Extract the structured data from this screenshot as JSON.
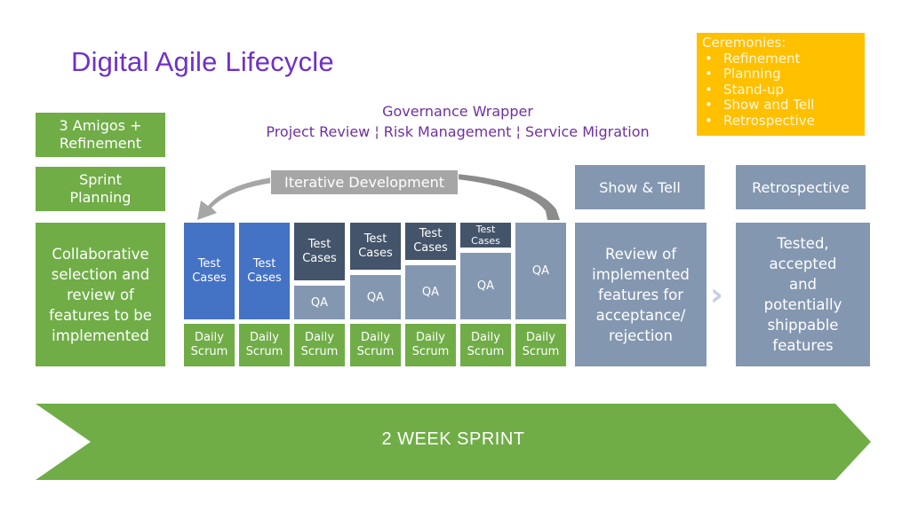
{
  "title": "Digital Agile Lifecycle",
  "ceremonies": {
    "heading": "Ceremonies:",
    "bullet": "•",
    "items": [
      "Refinement",
      "Planning",
      "Stand-up",
      "Show and Tell",
      "Retrospective"
    ]
  },
  "governance": {
    "heading": "Governance Wrapper",
    "items_line": "Project Review ¦ Risk Management ¦ Service Migration"
  },
  "left_column": {
    "amigos": "3 Amigos +\nRefinement",
    "sprint_planning": "Sprint\nPlanning",
    "planning_desc": "Collaborative\nselection and\nreview of\nfeatures to be\nimplemented"
  },
  "iterative_development": {
    "label": "Iterative Development",
    "arrow_icon": "curved-arrow-icon"
  },
  "sprint_days": [
    {
      "test_cases": "Test\nCases",
      "qa": null,
      "test_share": 1.0,
      "scrum": "Daily\nScrum"
    },
    {
      "test_cases": "Test\nCases",
      "qa": null,
      "test_share": 1.0,
      "scrum": "Daily\nScrum"
    },
    {
      "test_cases": "Test\nCases",
      "qa": "QA",
      "test_share": 0.62,
      "scrum": "Daily\nScrum"
    },
    {
      "test_cases": "Test\nCases",
      "qa": "QA",
      "test_share": 0.51,
      "scrum": "Daily\nScrum"
    },
    {
      "test_cases": "Test\nCases",
      "qa": "QA",
      "test_share": 0.41,
      "scrum": "Daily\nScrum"
    },
    {
      "test_cases": "Test\nCases",
      "qa": "QA",
      "test_share": 0.28,
      "scrum": "Daily\nScrum"
    },
    {
      "test_cases": null,
      "qa": "QA",
      "test_share": 0.0,
      "scrum": "Daily\nScrum"
    }
  ],
  "show_and_tell": {
    "label": "Show & Tell",
    "description": "Review of\nimplemented\nfeatures for\nacceptance/\nrejection"
  },
  "chevron_icon": "›",
  "retrospective": {
    "label": "Retrospective",
    "description": "Tested,\naccepted\nand\npotentially\nshippable\nfeatures"
  },
  "sprint_banner": "2 WEEK SPRINT",
  "colors": {
    "title_purple": "#7030c8",
    "governance_purple": "#7030a0",
    "green": "#70ad47",
    "blue": "#4472c4",
    "navy": "#44546a",
    "slate": "#8497b0",
    "gold": "#ffc000",
    "grey": "#a6a6a6"
  }
}
